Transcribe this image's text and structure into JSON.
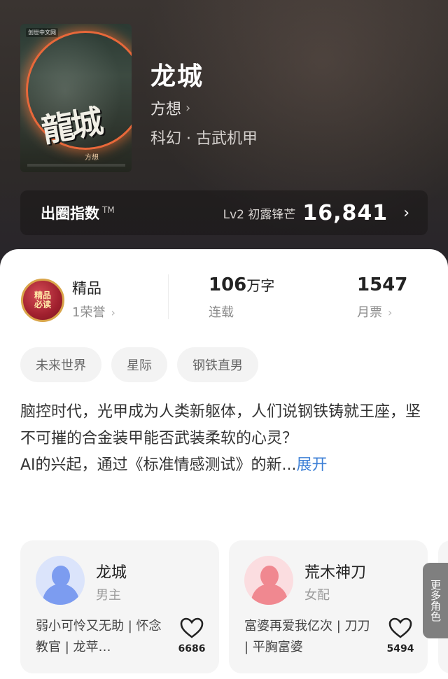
{
  "book": {
    "title": "龙城",
    "author": "方想",
    "genre": "科幻 · 古武机甲",
    "cover": {
      "publisher": "创世中文网",
      "title": "龍城",
      "author": "方想"
    }
  },
  "circle_index": {
    "label": "出圈指数",
    "tm": "TM",
    "level": "Lv2 初露锋芒",
    "score": "16,841"
  },
  "stats": {
    "badge_text": "精品\n必读",
    "quality_label": "精品",
    "honor": "1荣誉",
    "words_value": "106",
    "words_unit": "万字",
    "status": "连载",
    "monthly_tickets": "1547",
    "monthly_tickets_label": "月票"
  },
  "tags": [
    "未来世界",
    "星际",
    "钢铁直男"
  ],
  "synopsis": {
    "text": "脑控时代，光甲成为人类新躯体，人们说钢铁铸就王座，坚不可摧的合金装甲能否武装柔软的心灵？",
    "text2": "AI的兴起，通过《标准情感测试》的新...",
    "expand_label": "展开"
  },
  "characters": [
    {
      "name": "龙城",
      "role": "男主",
      "tags": "弱小可怜又无助 | 怀念教官 | 龙苹…",
      "likes": "6686",
      "avatar_color": "#7c9cf0"
    },
    {
      "name": "荒木神刀",
      "role": "女配",
      "tags": "富婆再爱我亿次 | 刀刀 | 平胸富婆",
      "likes": "5494",
      "avatar_color": "#f08890"
    }
  ],
  "more_roles_label": "更多角色",
  "colors": {
    "accent_link": "#3c7fd6",
    "hero_bg": "#332e2c"
  }
}
